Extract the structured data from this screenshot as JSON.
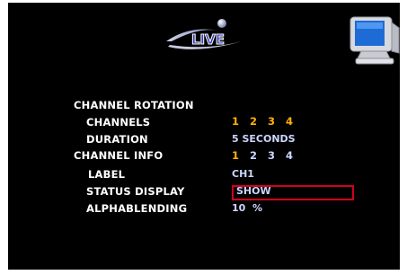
{
  "logo_text": "LIVE",
  "menu": {
    "channel_rotation": {
      "label": "CHANNEL ROTATION"
    },
    "channels": {
      "label": "CHANNELS",
      "values": [
        "1",
        "2",
        "3",
        "4"
      ]
    },
    "duration": {
      "label": "DURATION",
      "value": "5 SECONDS"
    },
    "channel_info": {
      "label": "CHANNEL INFO",
      "values": [
        "1",
        "2",
        "3",
        "4"
      ]
    },
    "label_row": {
      "label": "LABEL",
      "value": "CH1"
    },
    "status_display": {
      "label": "STATUS DISPLAY",
      "value": "SHOW"
    },
    "alphablending": {
      "label": "ALPHABLENDING",
      "value": "10  %"
    }
  },
  "colors": {
    "background": "#000000",
    "label_text": "#ffffff",
    "value_text": "#ccd6ff",
    "active_number": "#ffb300",
    "selection_border": "#d0021b",
    "logo_blue": "#3a3fb8"
  },
  "icons": [
    "live-logo-icon",
    "monitor-icon"
  ]
}
